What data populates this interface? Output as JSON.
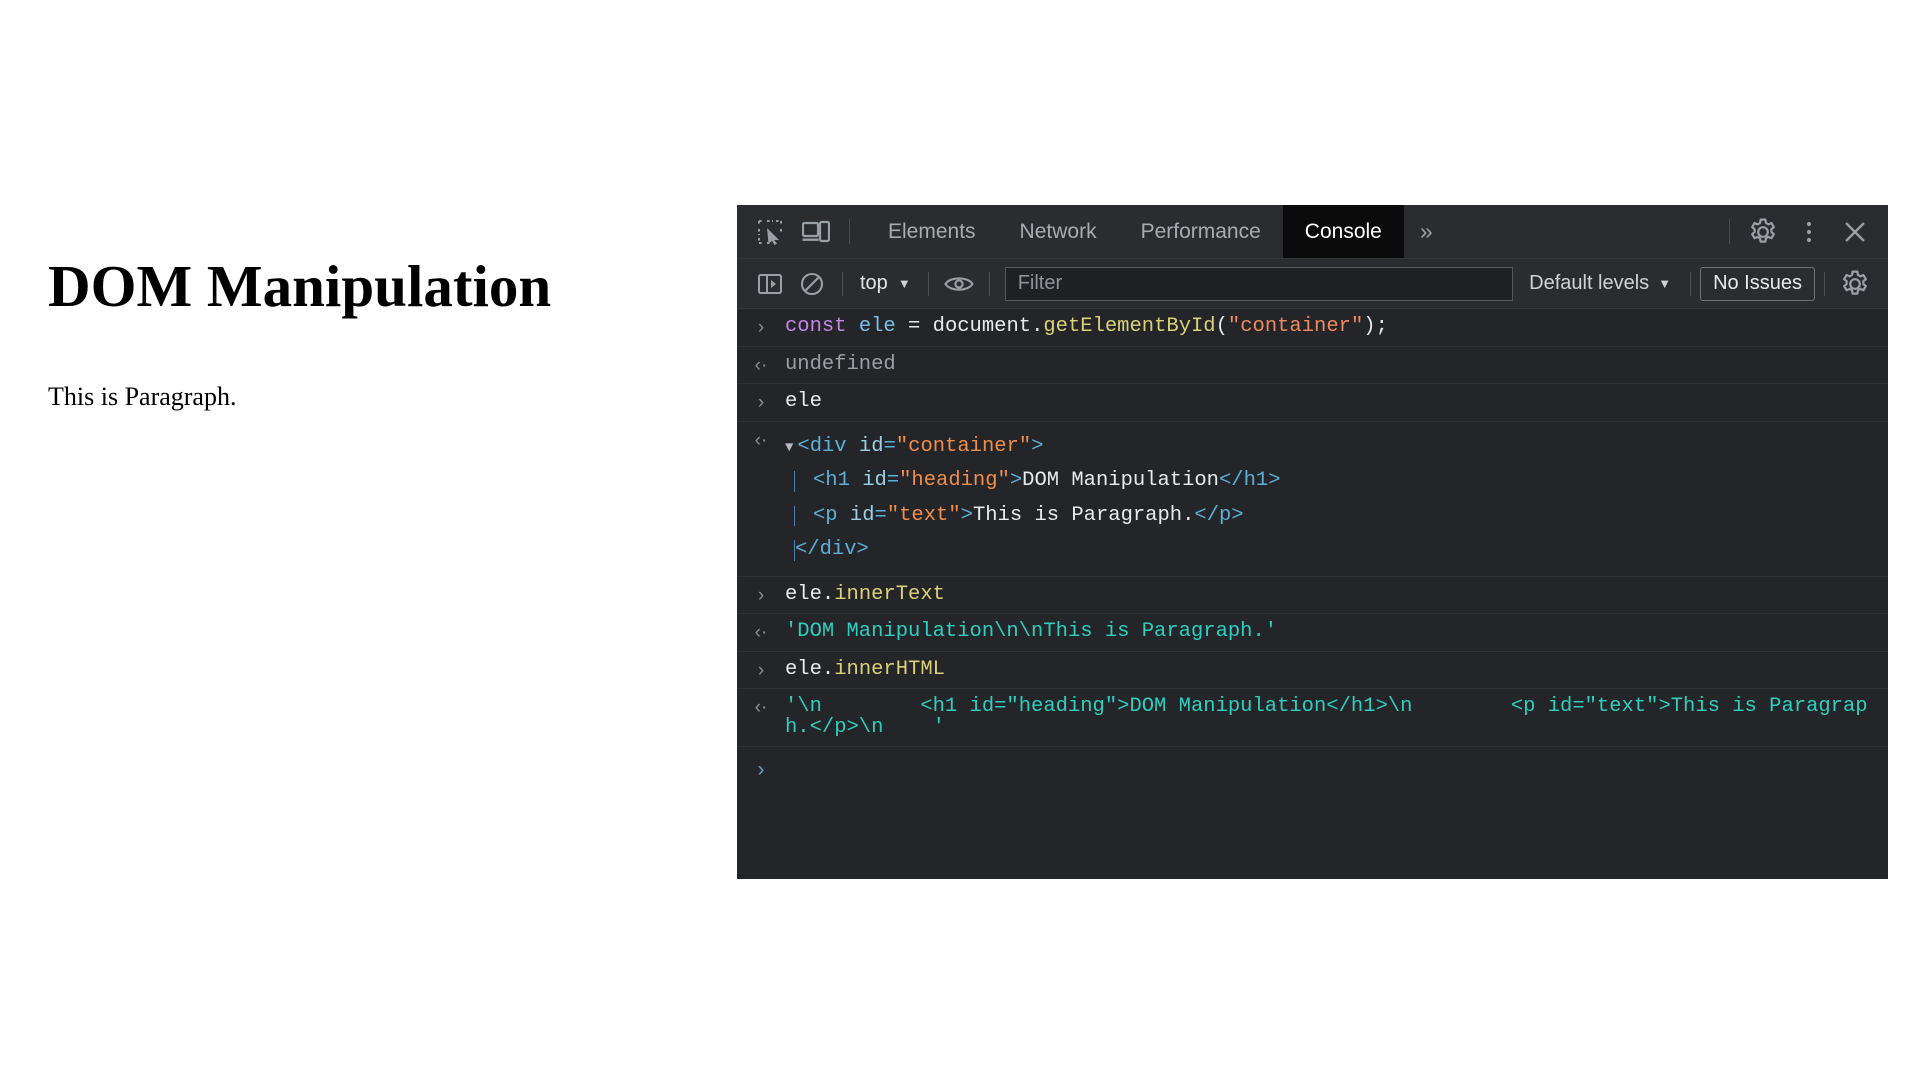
{
  "page": {
    "heading": "DOM Manipulation",
    "paragraph": "This is Paragraph."
  },
  "devtools": {
    "tabbar": {
      "inspect_icon": "inspect-element-icon",
      "device_icon": "device-toolbar-icon",
      "tabs": [
        {
          "label": "Elements",
          "active": false
        },
        {
          "label": "Network",
          "active": false
        },
        {
          "label": "Performance",
          "active": false
        },
        {
          "label": "Console",
          "active": true
        }
      ],
      "more_tabs_label": "»",
      "settings_icon": "gear-icon",
      "menu_icon": "kebab-menu-icon",
      "close_icon": "close-icon"
    },
    "console_toolbar": {
      "sidebar_icon": "console-sidebar-icon",
      "clear_icon": "clear-console-icon",
      "context_value": "top",
      "context_caret": "▼",
      "eye_icon": "live-expression-icon",
      "filter_value": "",
      "filter_placeholder": "Filter",
      "levels_label": "Default levels",
      "levels_caret": "▼",
      "issues_label": "No Issues",
      "settings_icon": "console-settings-gear-icon"
    },
    "console": {
      "entries": [
        {
          "kind": "input",
          "marker": "›",
          "tokens": [
            {
              "text": "const ",
              "cls": "t-kw"
            },
            {
              "text": "ele ",
              "cls": "t-var"
            },
            {
              "text": "= ",
              "cls": "t-plain"
            },
            {
              "text": "document",
              "cls": "t-plain"
            },
            {
              "text": ".",
              "cls": "t-punc"
            },
            {
              "text": "getElementById",
              "cls": "t-fn"
            },
            {
              "text": "(",
              "cls": "t-punc"
            },
            {
              "text": "\"container\"",
              "cls": "t-str"
            },
            {
              "text": ")",
              "cls": "t-punc"
            },
            {
              "text": ";",
              "cls": "t-punc"
            }
          ],
          "plain": "const ele = document.getElementById(\"container\");"
        },
        {
          "kind": "output",
          "marker": "‹·",
          "tokens": [
            {
              "text": "undefined",
              "cls": "t-undef"
            }
          ],
          "plain": "undefined"
        },
        {
          "kind": "input",
          "marker": "›",
          "tokens": [
            {
              "text": "ele",
              "cls": "t-plain"
            }
          ],
          "plain": "ele"
        },
        {
          "kind": "output-dom",
          "marker": "‹·",
          "dom_lines": [
            {
              "indent": 0,
              "toggle": "▼",
              "tokens": [
                {
                  "text": "<div",
                  "cls": "t-tag"
                },
                {
                  "text": " id",
                  "cls": "t-attr"
                },
                {
                  "text": "=",
                  "cls": "t-tag"
                },
                {
                  "text": "\"container\"",
                  "cls": "t-attrval"
                },
                {
                  "text": ">",
                  "cls": "t-tag"
                }
              ]
            },
            {
              "indent": 1,
              "toggle": "",
              "tokens": [
                {
                  "text": "<h1",
                  "cls": "t-tag"
                },
                {
                  "text": " id",
                  "cls": "t-attr"
                },
                {
                  "text": "=",
                  "cls": "t-tag"
                },
                {
                  "text": "\"heading\"",
                  "cls": "t-attrval"
                },
                {
                  "text": ">",
                  "cls": "t-tag"
                },
                {
                  "text": "DOM Manipulation",
                  "cls": "t-text"
                },
                {
                  "text": "</h1>",
                  "cls": "t-tag"
                }
              ]
            },
            {
              "indent": 1,
              "toggle": "",
              "tokens": [
                {
                  "text": "<p",
                  "cls": "t-tag"
                },
                {
                  "text": " id",
                  "cls": "t-attr"
                },
                {
                  "text": "=",
                  "cls": "t-tag"
                },
                {
                  "text": "\"text\"",
                  "cls": "t-attrval"
                },
                {
                  "text": ">",
                  "cls": "t-tag"
                },
                {
                  "text": "This is Paragraph.",
                  "cls": "t-text"
                },
                {
                  "text": "</p>",
                  "cls": "t-tag"
                }
              ]
            },
            {
              "indent": 0,
              "toggle": "",
              "tokens": [
                {
                  "text": "</div>",
                  "cls": "t-tag"
                }
              ]
            }
          ],
          "plain": "<div id=\"container\"> <h1 id=\"heading\">DOM Manipulation</h1> <p id=\"text\">This is Paragraph.</p> </div>"
        },
        {
          "kind": "input",
          "marker": "›",
          "tokens": [
            {
              "text": "ele",
              "cls": "t-plain"
            },
            {
              "text": ".",
              "cls": "t-punc"
            },
            {
              "text": "innerText",
              "cls": "t-prop"
            }
          ],
          "plain": "ele.innerText"
        },
        {
          "kind": "output",
          "marker": "‹·",
          "tokens": [
            {
              "text": "'DOM Manipulation\\n\\nThis is Paragraph.'",
              "cls": "t-strres"
            }
          ],
          "plain": "'DOM Manipulation\\n\\nThis is Paragraph.'"
        },
        {
          "kind": "input",
          "marker": "›",
          "tokens": [
            {
              "text": "ele",
              "cls": "t-plain"
            },
            {
              "text": ".",
              "cls": "t-punc"
            },
            {
              "text": "innerHTML",
              "cls": "t-prop"
            }
          ],
          "plain": "ele.innerHTML"
        },
        {
          "kind": "output",
          "marker": "‹·",
          "tokens": [
            {
              "text": "'\\n        <h1 id=\"heading\">DOM Manipulation</h1>\\n        <p id=\"text\">This is Paragraph.</p>\\n    '",
              "cls": "t-strres"
            }
          ],
          "plain": "'\\n        <h1 id=\"heading\">DOM Manipulation</h1>\\n        <p id=\"text\">This is Paragraph.</p>\\n    '"
        }
      ],
      "prompt_marker": "›",
      "prompt_value": ""
    }
  },
  "colors": {
    "panel_bg": "#242528",
    "toolbar_bg": "#2a2c2f",
    "active_tab_bg": "#0b0b0c",
    "accent_blue": "#6b9bd2",
    "string_teal": "#2ecfc0",
    "attr_orange": "#f08d49"
  }
}
